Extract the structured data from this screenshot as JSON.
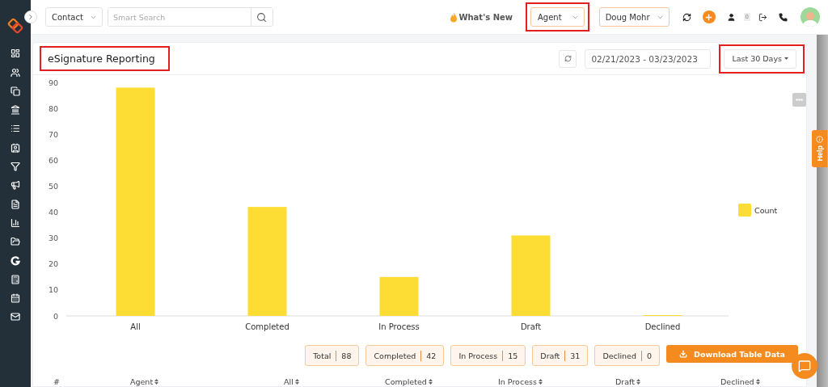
{
  "top_bar": {
    "module_select": "Contact",
    "search": {
      "placeholder": "Smart Search"
    },
    "whats_new": "What's New",
    "role_select": {
      "value": "Agent",
      "highlighted": true
    },
    "user_select": "Doug Mohr",
    "notification_count": "0"
  },
  "report": {
    "title": "eSignature Reporting",
    "title_highlighted": true,
    "date_range": "02/21/2023 - 03/23/2023",
    "range_button": {
      "label": "Last 30 Days",
      "highlighted": true
    },
    "chart_data": {
      "type": "bar",
      "categories": [
        "All",
        "Completed",
        "In Process",
        "Draft",
        "Declined"
      ],
      "series": [
        {
          "name": "Count",
          "color": "#fddd33",
          "values": [
            88,
            42,
            15,
            31,
            0
          ]
        }
      ],
      "ylim": [
        0,
        90
      ],
      "yticks": [
        0,
        10,
        20,
        30,
        40,
        50,
        60,
        70,
        80,
        90
      ]
    }
  },
  "summary": [
    {
      "label": "Total",
      "value": "88"
    },
    {
      "label": "Completed",
      "value": "42"
    },
    {
      "label": "In Process",
      "value": "15"
    },
    {
      "label": "Draft",
      "value": "31"
    },
    {
      "label": "Declined",
      "value": "0"
    }
  ],
  "download_button": "Download Table Data",
  "table": {
    "columns": [
      {
        "label": "#",
        "sortable": false
      },
      {
        "label": "Agent",
        "sortable": true
      },
      {
        "label": "All",
        "sortable": true
      },
      {
        "label": "Completed",
        "sortable": true
      },
      {
        "label": "In Process",
        "sortable": true
      },
      {
        "label": "Draft",
        "sortable": true
      },
      {
        "label": "Declined",
        "sortable": true
      }
    ]
  },
  "help_tab": "Help"
}
